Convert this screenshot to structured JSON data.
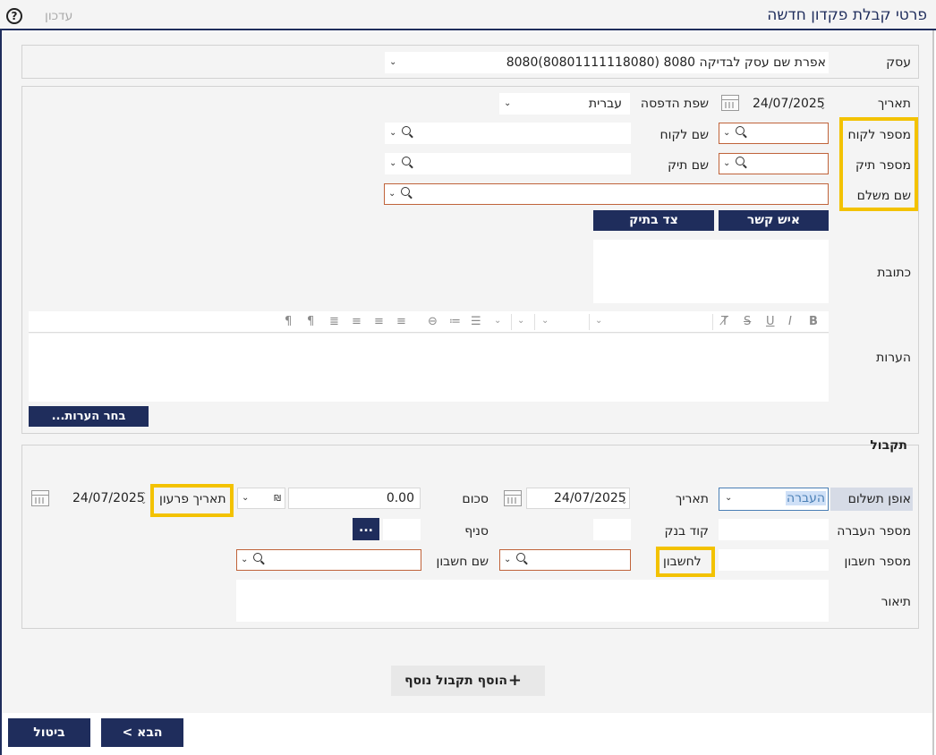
{
  "header": {
    "title": "פרטי קבלת פקדון חדשה",
    "update_link": "עדכון",
    "help_symbol": "?"
  },
  "business": {
    "label": "עסק",
    "value": "8080אפרת שם עסק לבדיקה 8080 (80801111118080)"
  },
  "details": {
    "date_label": "תאריך",
    "date_value": "24/07/2025",
    "print_lang_label": "שפת הדפסה",
    "print_lang_value": "עברית",
    "customer_number_label": "מספר לקוח",
    "customer_name_label": "שם לקוח",
    "file_number_label": "מספר תיק",
    "file_name_label": "שם תיק",
    "payer_name_label": "שם משלם",
    "contact_button": "איש קשר",
    "party_button": "צד בתיק",
    "address_label": "כתובת",
    "notes_label": "הערות",
    "choose_notes_button": "בחר הערות...",
    "toolbar_icons": [
      "bold-icon",
      "italic-icon",
      "underline-icon",
      "strikethrough-icon",
      "clear-format-icon",
      "font-size-select",
      "font-family-select",
      "color-select",
      "bullets-icon",
      "numbered-list-icon",
      "link-icon",
      "align-right-icon",
      "align-center-icon",
      "align-left-icon",
      "justify-icon",
      "paragraph-rtl-icon",
      "paragraph-ltr-icon"
    ]
  },
  "payment": {
    "section_title": "תקבול",
    "method_label": "אופן תשלום",
    "method_value": "העברה",
    "date_label": "תאריך",
    "date_value": "24/07/2025",
    "amount_label": "סכום",
    "amount_value": "0.00",
    "currency_symbol": "₪",
    "maturity_date_label": "תאריך פרעון",
    "maturity_date_value": "24/07/2025",
    "transfer_number_label": "מספר העברה",
    "bank_code_label": "קוד בנק",
    "branch_label": "סניף",
    "ellipsis_button": "...",
    "account_number_label": "מספר חשבון",
    "to_account_label": "לחשבון",
    "account_name_label": "שם חשבון",
    "description_label": "תיאור",
    "add_payment_button": "הוסף תקבול נוסף",
    "add_symbol": "+"
  },
  "footer": {
    "next_button": "הבא >",
    "cancel_button": "ביטול"
  },
  "colors": {
    "navy": "#1f2d5c",
    "highlight": "#f3c200",
    "error_border": "#c0633a"
  }
}
